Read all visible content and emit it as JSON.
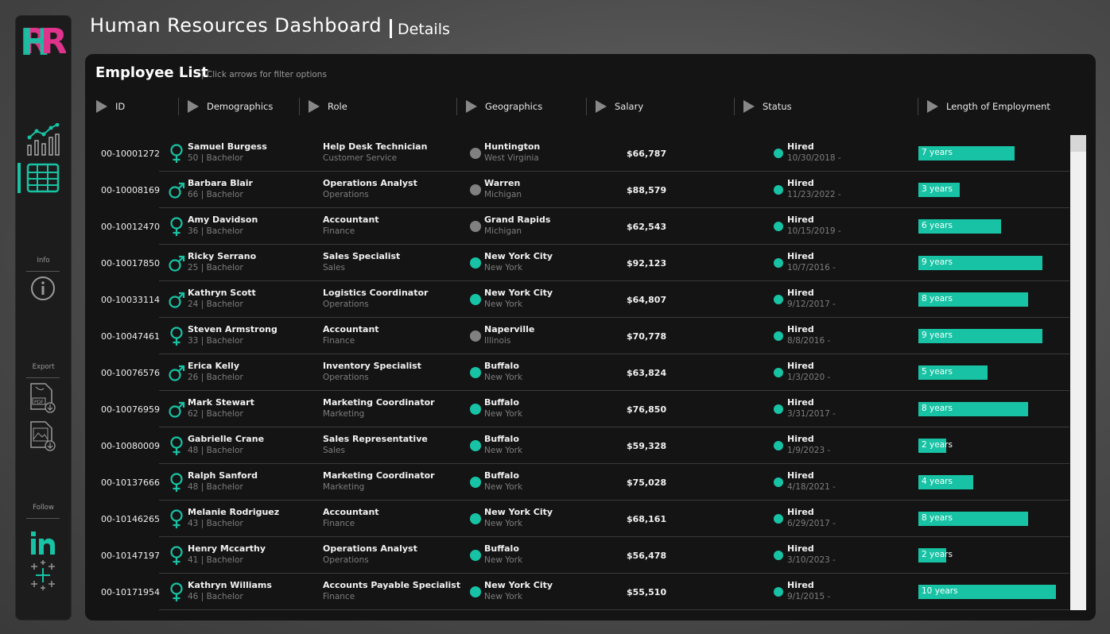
{
  "header": {
    "title": "Human Resources Dashboard",
    "subtitle": "Details"
  },
  "sidebar": {
    "logo": "HR",
    "info_label": "Info",
    "export_label": "Export",
    "follow_label": "Follow",
    "icons": [
      "line-chart-icon",
      "table-icon",
      "info-icon",
      "pdf-download-icon",
      "image-download-icon",
      "linkedin-icon",
      "tableau-icon"
    ]
  },
  "panel": {
    "title": "Employee List",
    "hint": "| Click arrows for filter options",
    "columns": [
      "ID",
      "Demographics",
      "Role",
      "Geographics",
      "Salary",
      "Status",
      "Length of Employment"
    ]
  },
  "colors": {
    "accent": "#17c3a4",
    "magenta": "#e0338c",
    "gray_dot": "#808080"
  },
  "employees": [
    {
      "id": "00-10001272",
      "gender": "female",
      "name": "Samuel Burgess",
      "age_edu": "50 | Bachelor",
      "role": "Help Desk Technician",
      "dept": "Customer Service",
      "city": "Huntington",
      "state": "West Virginia",
      "geo": "gray",
      "salary": "$66,787",
      "status": "Hired",
      "date": "10/30/2018 -",
      "years": "7 years",
      "years_num": 7
    },
    {
      "id": "00-10008169",
      "gender": "male",
      "name": "Barbara Blair",
      "age_edu": "66 | Bachelor",
      "role": "Operations Analyst",
      "dept": "Operations",
      "city": "Warren",
      "state": "Michigan",
      "geo": "gray",
      "salary": "$88,579",
      "status": "Hired",
      "date": "11/23/2022 -",
      "years": "3 years",
      "years_num": 3
    },
    {
      "id": "00-10012470",
      "gender": "female",
      "name": "Amy Davidson",
      "age_edu": "36 | Bachelor",
      "role": "Accountant",
      "dept": "Finance",
      "city": "Grand Rapids",
      "state": "Michigan",
      "geo": "gray",
      "salary": "$62,543",
      "status": "Hired",
      "date": "10/15/2019 -",
      "years": "6 years",
      "years_num": 6
    },
    {
      "id": "00-10017850",
      "gender": "male",
      "name": "Ricky Serrano",
      "age_edu": "25 | Bachelor",
      "role": "Sales Specialist",
      "dept": "Sales",
      "city": "New York City",
      "state": "New York",
      "geo": "teal",
      "salary": "$92,123",
      "status": "Hired",
      "date": "10/7/2016 -",
      "years": "9 years",
      "years_num": 9
    },
    {
      "id": "00-10033114",
      "gender": "male",
      "name": "Kathryn Scott",
      "age_edu": "24 | Bachelor",
      "role": "Logistics Coordinator",
      "dept": "Operations",
      "city": "New York City",
      "state": "New York",
      "geo": "teal",
      "salary": "$64,807",
      "status": "Hired",
      "date": "9/12/2017 -",
      "years": "8 years",
      "years_num": 8
    },
    {
      "id": "00-10047461",
      "gender": "female",
      "name": "Steven Armstrong",
      "age_edu": "33 | Bachelor",
      "role": "Accountant",
      "dept": "Finance",
      "city": "Naperville",
      "state": "Illinois",
      "geo": "gray",
      "salary": "$70,778",
      "status": "Hired",
      "date": "8/8/2016 -",
      "years": "9 years",
      "years_num": 9
    },
    {
      "id": "00-10076576",
      "gender": "male",
      "name": "Erica Kelly",
      "age_edu": "26 | Bachelor",
      "role": "Inventory Specialist",
      "dept": "Operations",
      "city": "Buffalo",
      "state": "New York",
      "geo": "teal",
      "salary": "$63,824",
      "status": "Hired",
      "date": "1/3/2020 -",
      "years": "5 years",
      "years_num": 5
    },
    {
      "id": "00-10076959",
      "gender": "male",
      "name": "Mark Stewart",
      "age_edu": "62 | Bachelor",
      "role": "Marketing Coordinator",
      "dept": "Marketing",
      "city": "Buffalo",
      "state": "New York",
      "geo": "teal",
      "salary": "$76,850",
      "status": "Hired",
      "date": "3/31/2017 -",
      "years": "8 years",
      "years_num": 8
    },
    {
      "id": "00-10080009",
      "gender": "female",
      "name": "Gabrielle Crane",
      "age_edu": "48 | Bachelor",
      "role": "Sales Representative",
      "dept": "Sales",
      "city": "Buffalo",
      "state": "New York",
      "geo": "teal",
      "salary": "$59,328",
      "status": "Hired",
      "date": "1/9/2023 -",
      "years": "2 years",
      "years_num": 2
    },
    {
      "id": "00-10137666",
      "gender": "female",
      "name": "Ralph Sanford",
      "age_edu": "48 | Bachelor",
      "role": "Marketing Coordinator",
      "dept": "Marketing",
      "city": "Buffalo",
      "state": "New York",
      "geo": "teal",
      "salary": "$75,028",
      "status": "Hired",
      "date": "4/18/2021 -",
      "years": "4 years",
      "years_num": 4
    },
    {
      "id": "00-10146265",
      "gender": "female",
      "name": "Melanie Rodriguez",
      "age_edu": "43 | Bachelor",
      "role": "Accountant",
      "dept": "Finance",
      "city": "New York City",
      "state": "New York",
      "geo": "teal",
      "salary": "$68,161",
      "status": "Hired",
      "date": "6/29/2017 -",
      "years": "8 years",
      "years_num": 8
    },
    {
      "id": "00-10147197",
      "gender": "female",
      "name": "Henry Mccarthy",
      "age_edu": "41 | Bachelor",
      "role": "Operations Analyst",
      "dept": "Operations",
      "city": "Buffalo",
      "state": "New York",
      "geo": "teal",
      "salary": "$56,478",
      "status": "Hired",
      "date": "3/10/2023 -",
      "years": "2 years",
      "years_num": 2
    },
    {
      "id": "00-10171954",
      "gender": "female",
      "name": "Kathryn Williams",
      "age_edu": "46 | Bachelor",
      "role": "Accounts Payable Specialist",
      "dept": "Finance",
      "city": "New York City",
      "state": "New York",
      "geo": "teal",
      "salary": "$55,510",
      "status": "Hired",
      "date": "9/1/2015 -",
      "years": "10 years",
      "years_num": 10
    }
  ]
}
